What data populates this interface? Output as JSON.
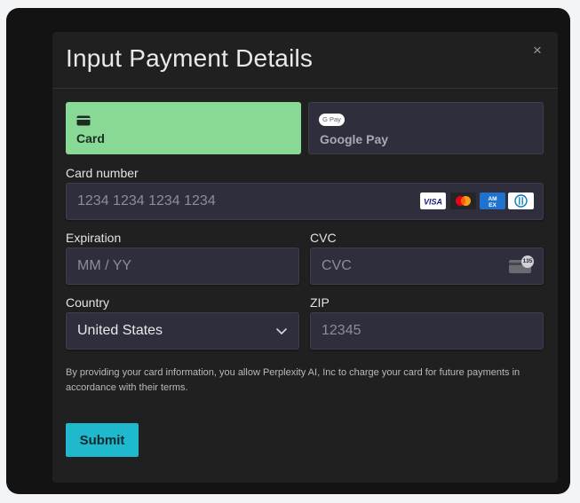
{
  "modal": {
    "title": "Input Payment Details",
    "close_symbol": "×"
  },
  "payment_methods": [
    {
      "label": "Card",
      "icon": "credit-card-icon",
      "selected": true
    },
    {
      "label": "Google Pay",
      "icon": "google-pay-icon",
      "badge": "G Pay",
      "selected": false
    }
  ],
  "card_number": {
    "label": "Card number",
    "placeholder": "1234 1234 1234 1234",
    "value": "",
    "brands": [
      "VISA",
      "Mastercard",
      "AMEX",
      "Diners Club"
    ]
  },
  "expiration": {
    "label": "Expiration",
    "placeholder": "MM / YY",
    "value": ""
  },
  "cvc": {
    "label": "CVC",
    "placeholder": "CVC",
    "value": "",
    "hint_icon": "cvc-card-icon",
    "hint_text": "135"
  },
  "country": {
    "label": "Country",
    "value": "United States"
  },
  "zip": {
    "label": "ZIP",
    "placeholder": "12345",
    "value": ""
  },
  "terms_text": "By providing your card information, you allow Perplexity AI, Inc to charge your card for future payments in accordance with their terms.",
  "submit_label": "Submit",
  "colors": {
    "selected_method": "#88d995",
    "submit": "#20b8cd",
    "field_bg": "#2e2e3c",
    "modal_bg": "#202020"
  }
}
